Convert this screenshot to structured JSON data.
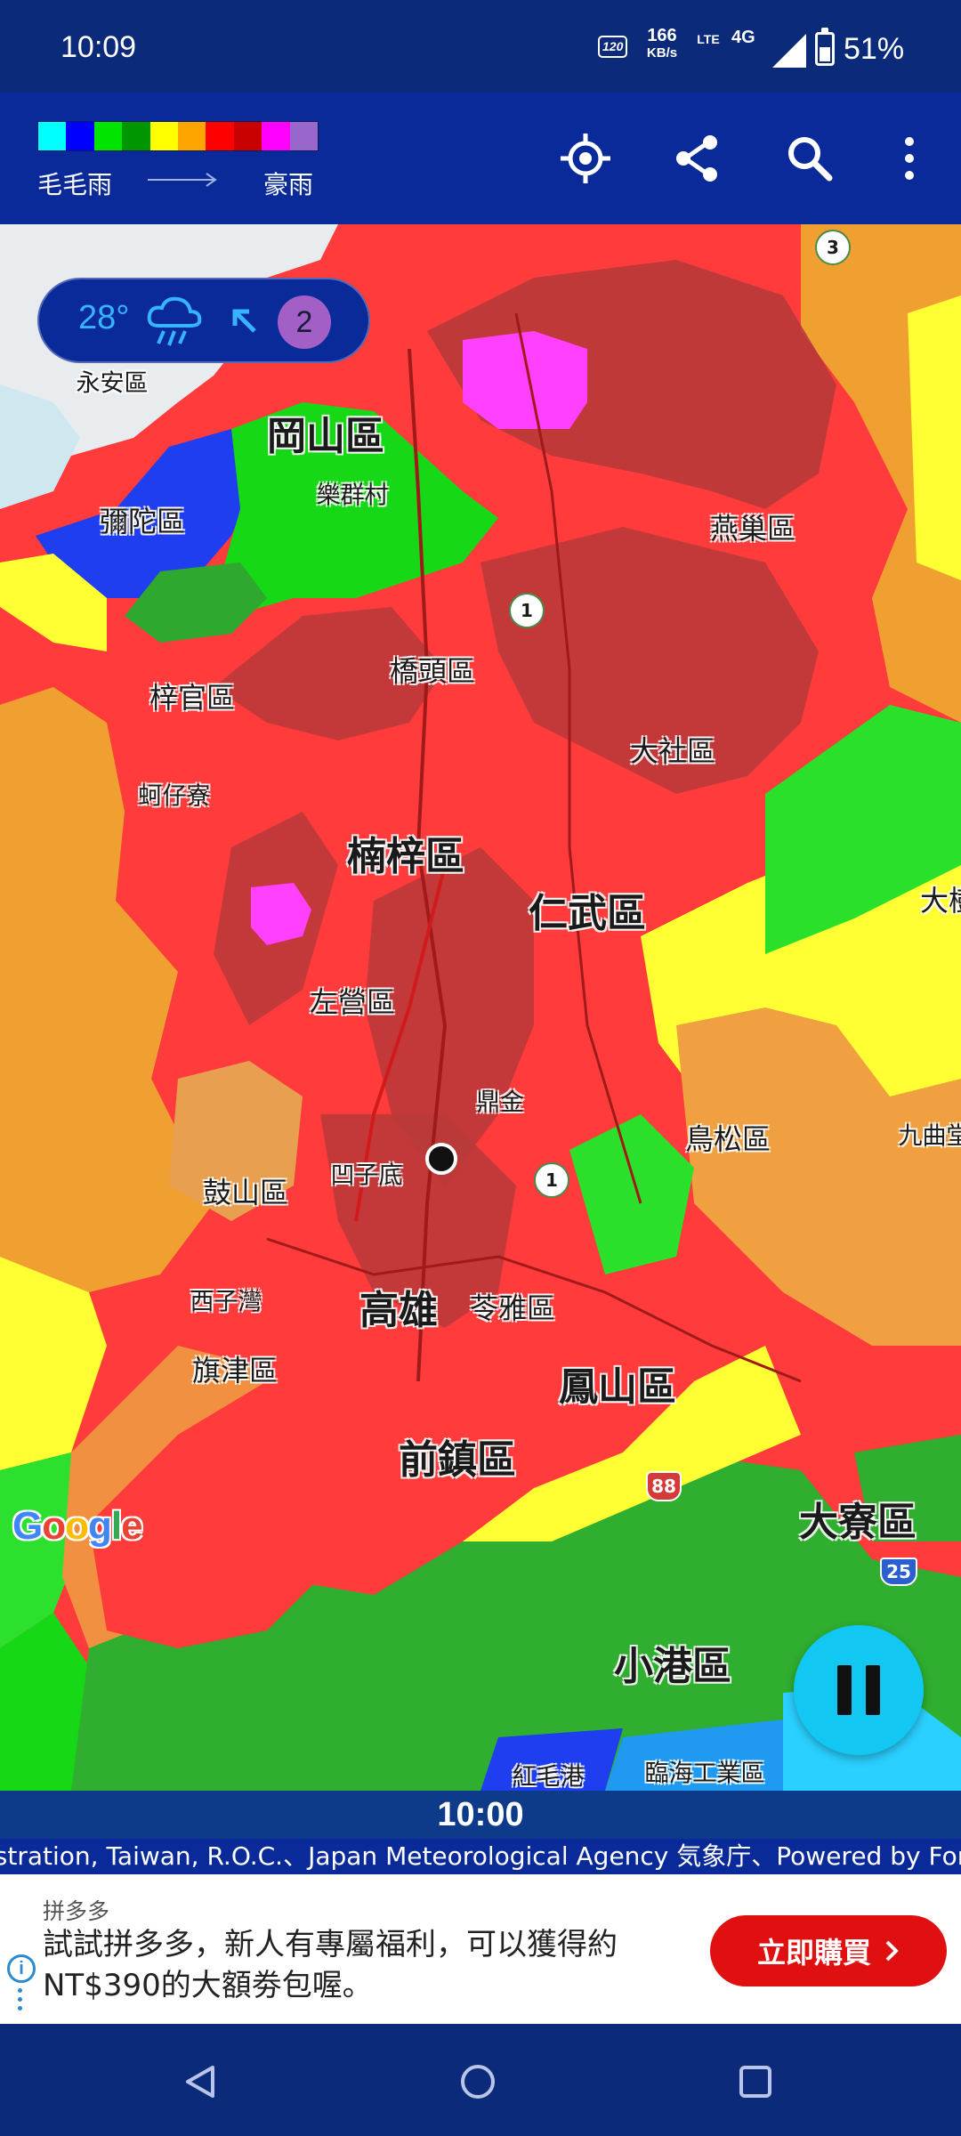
{
  "status_bar": {
    "time": "10:09",
    "refresh_rate": "120",
    "net_speed_value": "166",
    "net_speed_unit": "KB/s",
    "volte_label": "LTE",
    "network": "4G",
    "battery_percent": "51%",
    "battery_level": 0.51
  },
  "app_bar": {
    "legend": {
      "min_label": "毛毛雨",
      "max_label": "豪雨",
      "colors": [
        "#00ffff",
        "#0000ff",
        "#00e400",
        "#009600",
        "#ffff00",
        "#ffa500",
        "#ff0000",
        "#c80000",
        "#ff00ff",
        "#9966cc"
      ]
    },
    "icons": {
      "locate": "my-location-icon",
      "share": "share-icon",
      "search": "search-icon",
      "more": "more-vert-icon"
    }
  },
  "weather_pill": {
    "temperature": "28°",
    "condition_icon": "heavy-rain-icon",
    "wind_icon": "wind-direction-arrow-icon",
    "wind_level": "2"
  },
  "map": {
    "places": [
      {
        "name": "永安區"
      },
      {
        "name": "岡山區"
      },
      {
        "name": "樂群村"
      },
      {
        "name": "彌陀區"
      },
      {
        "name": "燕巢區"
      },
      {
        "name": "橋頭區"
      },
      {
        "name": "梓官區"
      },
      {
        "name": "大社區"
      },
      {
        "name": "蚵仔寮"
      },
      {
        "name": "楠梓區"
      },
      {
        "name": "仁武區"
      },
      {
        "name": "大樹"
      },
      {
        "name": "左營區"
      },
      {
        "name": "鼎金"
      },
      {
        "name": "鳥松區"
      },
      {
        "name": "九曲堂"
      },
      {
        "name": "鼓山區"
      },
      {
        "name": "凹子底"
      },
      {
        "name": "西子灣"
      },
      {
        "name": "高雄"
      },
      {
        "name": "苓雅區"
      },
      {
        "name": "旗津區"
      },
      {
        "name": "鳳山區"
      },
      {
        "name": "前鎮區"
      },
      {
        "name": "大寮區"
      },
      {
        "name": "小港區"
      },
      {
        "name": "紅毛港"
      },
      {
        "name": "臨海工業區"
      }
    ],
    "route_shields": [
      "3",
      "1",
      "1",
      "88",
      "25"
    ],
    "logo": "Google"
  },
  "playback": {
    "time": "10:00",
    "pause_icon": "pause-icon"
  },
  "attribution": "istration, Taiwan, R.O.C.、Japan Meteorological Agency 気象庁、Powered by For",
  "ad": {
    "brand": "拼多多",
    "text": "試試拼多多，新人有專屬福利，可以獲得約NT$390的大額劵包喔。",
    "cta": "立即購買"
  },
  "nav_bar": {
    "back_icon": "back-triangle-icon",
    "home_icon": "home-circle-icon",
    "recents_icon": "recents-square-icon"
  }
}
